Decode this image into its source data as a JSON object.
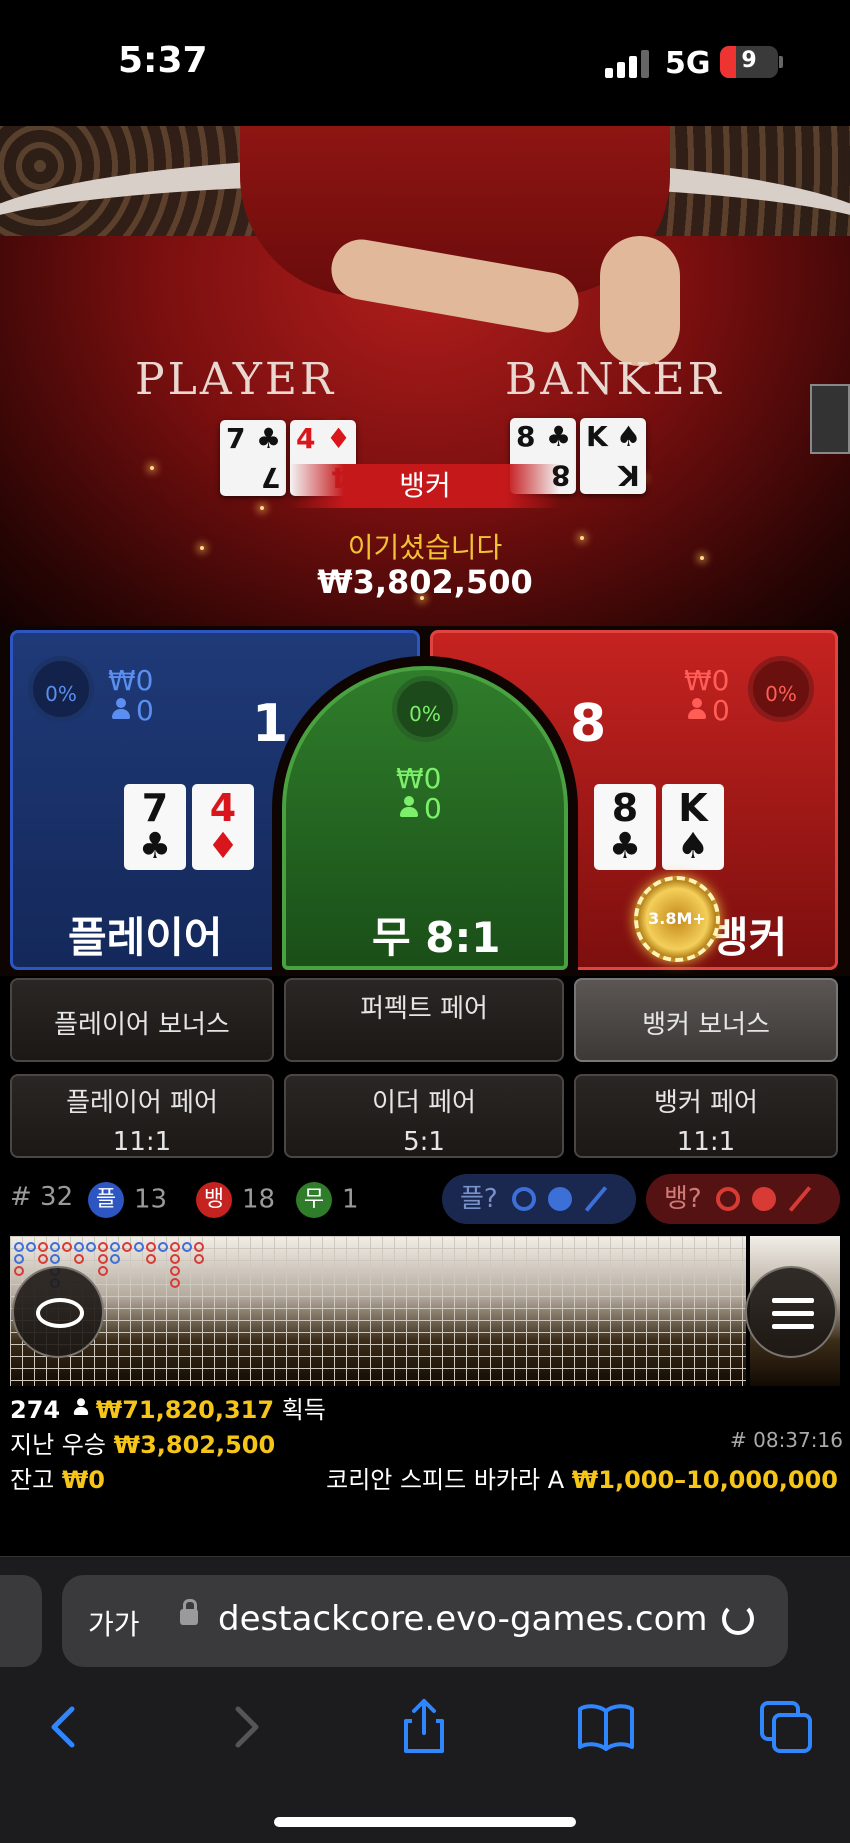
{
  "status_bar": {
    "time": "5:37",
    "network": "5G",
    "battery": "9",
    "battery_level_percent": 9
  },
  "video": {
    "player_label": "PLAYER",
    "banker_label": "BANKER",
    "player_cards": [
      {
        "rank": "7",
        "suit": "♣",
        "color": "black"
      },
      {
        "rank": "4",
        "suit": "♦",
        "color": "red"
      }
    ],
    "banker_cards": [
      {
        "rank": "8",
        "suit": "♣",
        "color": "black"
      },
      {
        "rank": "K",
        "suit": "♠",
        "color": "black"
      }
    ],
    "winner": "뱅커",
    "win_message": "이기셨습니다",
    "win_amount": "₩3,802,500"
  },
  "bet_area": {
    "player": {
      "percent": "0%",
      "amount": "₩0",
      "players": "0",
      "score": "1",
      "title": "플레이어",
      "cards": [
        {
          "rank": "7",
          "suit": "♣",
          "color": "black"
        },
        {
          "rank": "4",
          "suit": "♦",
          "color": "red"
        }
      ]
    },
    "tie": {
      "percent": "0%",
      "amount": "₩0",
      "players": "0",
      "title": "무 8:1"
    },
    "banker": {
      "percent": "0%",
      "amount": "₩0",
      "players": "0",
      "score": "8",
      "title": "뱅커",
      "cards": [
        {
          "rank": "8",
          "suit": "♣",
          "color": "black"
        },
        {
          "rank": "K",
          "suit": "♠",
          "color": "black"
        }
      ],
      "chip": "3.8M+"
    }
  },
  "side_bets": {
    "player_bonus": "플레이어 보너스",
    "perfect_pair": "퍼펙트 페어",
    "banker_bonus": "뱅커 보너스",
    "player_pair": "플레이어 페어",
    "player_pair_odds": "11:1",
    "either_pair": "이더 페어",
    "either_pair_odds": "5:1",
    "banker_pair": "뱅커 페어",
    "banker_pair_odds": "11:1"
  },
  "road_stats": {
    "round_label": "# 32",
    "player_label": "플",
    "player_count": "13",
    "banker_label": "뱅",
    "banker_count": "18",
    "tie_label": "무",
    "tie_count": "1",
    "player_predict": "플?",
    "banker_predict": "뱅?"
  },
  "info": {
    "players_online": "274",
    "total_won": "₩71,820,317",
    "won_label": "획득",
    "last_win_label": "지난 우승",
    "last_win_amount": "₩3,802,500",
    "game_id": "# 08:37:16",
    "balance_label": "잔고",
    "balance": "₩0",
    "table_name": "코리안 스피드 바카라 A",
    "limits": "₩1,000–10,000,000"
  },
  "browser": {
    "text_size": "가가",
    "url": "destackcore.evo-games.com"
  },
  "colors": {
    "player_blue": "#2d56c2",
    "banker_red": "#c52320",
    "tie_green": "#2f7d2b",
    "gold": "#f5c518"
  }
}
